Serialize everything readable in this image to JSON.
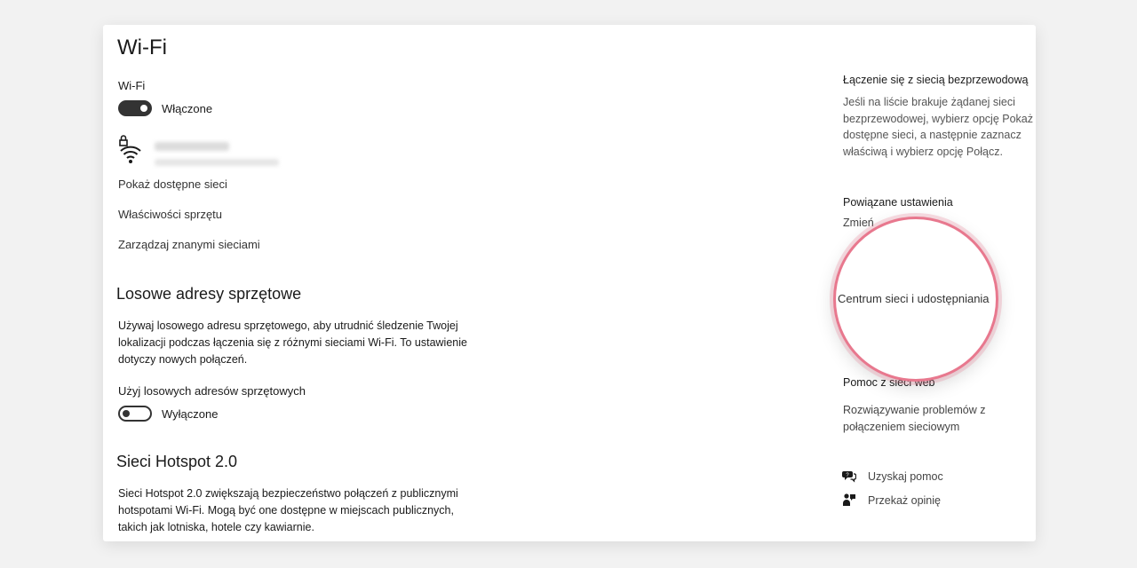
{
  "page": {
    "title": "Wi-Fi"
  },
  "wifi": {
    "label": "Wi-Fi",
    "toggle_state": "Włączone",
    "show_networks": "Pokaż dostępne sieci",
    "hardware_props": "Właściwości sprzętu",
    "manage_networks": "Zarządzaj znanymi sieciami"
  },
  "random_hw": {
    "heading": "Losowe adresy sprzętowe",
    "description_lines": [
      "Używaj losowego adresu sprzętowego, aby utrudnić śledzenie Twojej",
      "lokalizacji podczas łączenia się z różnymi sieciami Wi-Fi. To ustawienie",
      "dotyczy nowych połączeń."
    ],
    "toggle_label": "Użyj losowych adresów sprzętowych",
    "toggle_state": "Wyłączone"
  },
  "hotspot": {
    "heading": "Sieci Hotspot 2.0",
    "description_lines": [
      "Sieci Hotspot 2.0 zwiększają bezpieczeństwo połączeń z publicznymi",
      "hotspotami Wi-Fi. Mogą być one dostępne w miejscach publicznych,",
      "takich jak lotniska, hotele czy kawiarnie."
    ]
  },
  "sidebar": {
    "connect_heading": "Łączenie się z siecią bezprzewodową",
    "connect_lines": [
      "Jeśli na liście brakuje żądanej sieci",
      "bezprzewodowej, wybierz opcję Pokaż",
      "dostępne sieci, a następnie zaznacz",
      "właściwą i wybierz opcję Połącz."
    ],
    "related_heading": "Powiązane ustawienia",
    "related_partial": "Zmień",
    "network_center": "Centrum sieci i udostępniania",
    "help_heading": "Pomoc z sieci web",
    "troubleshoot_lines": [
      "Rozwiązywanie problemów z",
      "połączeniem sieciowym"
    ],
    "get_help": "Uzyskaj pomoc",
    "feedback": "Przekaż opinię"
  },
  "colors": {
    "highlight_ring": "#e8788e",
    "toggle_on": "#333333"
  },
  "icons": [
    "wifi-secured-icon",
    "help-chat-icon",
    "feedback-icon"
  ]
}
